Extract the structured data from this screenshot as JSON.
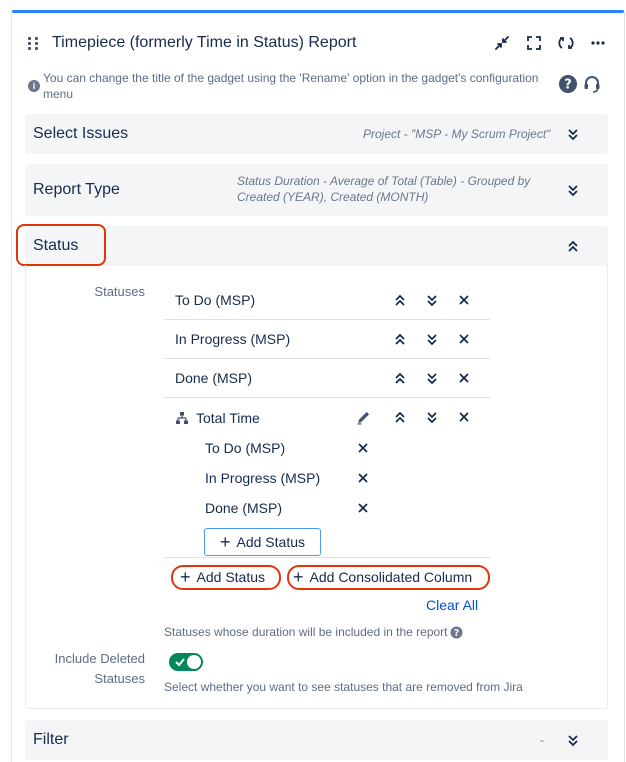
{
  "header": {
    "title": "Timepiece (formerly Time in Status) Report"
  },
  "info": {
    "text": "You can change the title of the gadget using the 'Rename' option in the gadget's configuration menu"
  },
  "sections": {
    "select_issues": {
      "label": "Select Issues",
      "summary": "Project - \"MSP - My Scrum Project\""
    },
    "report_type": {
      "label": "Report Type",
      "summary": "Status Duration - Average of Total (Table) - Grouped by Created (YEAR), Created (MONTH)"
    },
    "status": {
      "label": "Status"
    },
    "filter": {
      "label": "Filter",
      "summary": "-"
    }
  },
  "status_panel": {
    "statuses_label": "Statuses",
    "rows": [
      {
        "name": "To Do (MSP)"
      },
      {
        "name": "In Progress (MSP)"
      },
      {
        "name": "Done (MSP)"
      }
    ],
    "consolidated": {
      "name": "Total Time",
      "children": [
        "To Do (MSP)",
        "In Progress (MSP)",
        "Done (MSP)"
      ],
      "add_status_label": "Add Status"
    },
    "add_status_label": "Add Status",
    "add_consolidated_label": "Add Consolidated Column",
    "clear_all_label": "Clear All",
    "statuses_help": "Statuses whose duration will be included in the report",
    "include_deleted_label": "Include Deleted Statuses",
    "include_deleted_value": true,
    "include_deleted_help": "Select whether you want to see statuses that are removed from Jira"
  },
  "colors": {
    "accent": "#0052cc",
    "highlight": "#de350b",
    "toggle_on": "#00875a",
    "top_bar": "#2684ff"
  },
  "icons": {
    "header": [
      "minimize-icon",
      "fullscreen-icon",
      "refresh-icon",
      "more-icon"
    ],
    "help": [
      "help-icon",
      "support-headset-icon"
    ]
  }
}
